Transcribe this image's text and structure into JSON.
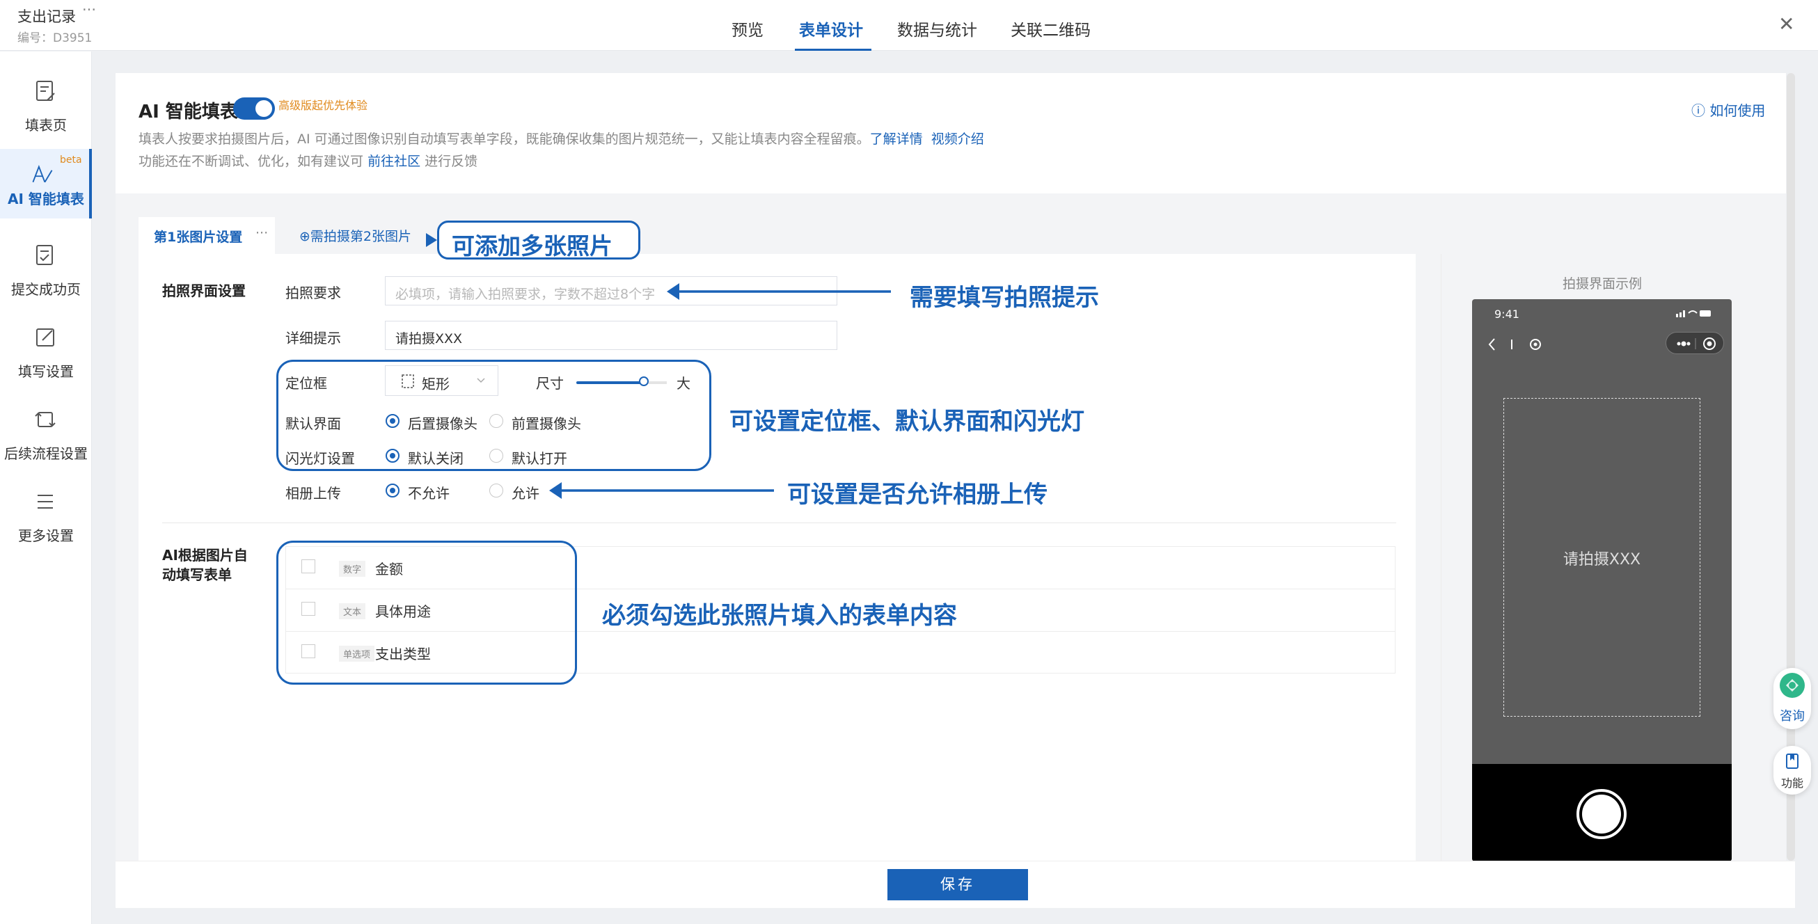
{
  "header": {
    "title": "支出记录",
    "more": "···",
    "subtitle": "编号：D3951",
    "tabs": [
      "预览",
      "表单设计",
      "数据与统计",
      "关联二维码"
    ],
    "active_tab": "表单设计",
    "close": "✕"
  },
  "sidebar": {
    "items": [
      {
        "label": "填表页",
        "icon": "form-page-icon"
      },
      {
        "label": "AI 智能填表",
        "icon": "ai-fill-icon",
        "badge": "beta",
        "active": true
      },
      {
        "label": "提交成功页",
        "icon": "submit-success-icon"
      },
      {
        "label": "填写设置",
        "icon": "fill-settings-icon"
      },
      {
        "label": "后续流程设置",
        "icon": "workflow-icon"
      },
      {
        "label": "更多设置",
        "icon": "more-settings-icon"
      }
    ]
  },
  "ai_panel": {
    "title": "AI 智能填表",
    "toggle_on": true,
    "trial": "高级版起优先体验",
    "help": "如何使用",
    "desc_line1": "填表人按要求拍摄图片后，AI 可通过图像识别自动填写表单字段，既能确保收集的图片规范统一，又能让填表内容全程留痕。",
    "desc_link1": "了解详情",
    "desc_link2": "视频介绍",
    "desc_line2_a": "功能还在不断调试、优化，如有建议可",
    "desc_link3": "前往社区",
    "desc_line2_b": "进行反馈"
  },
  "photo_tabs": {
    "tab1": "第1张图片设置",
    "tab1_more": "···",
    "add": "⊕需拍摄第2张图片"
  },
  "capture_settings": {
    "section": "拍照界面设置",
    "requirement_label": "拍照要求",
    "requirement_placeholder": "必填项，请输入拍照要求，字数不超过8个字",
    "detail_label": "详细提示",
    "detail_value": "请拍摄XXX",
    "frame_label": "定位框",
    "frame_value": "矩形",
    "size_label": "尺寸",
    "size_value": "大",
    "size_level": 0.75,
    "default_view_label": "默认界面",
    "default_view_options": [
      "后置摄像头",
      "前置摄像头"
    ],
    "default_view_selected": "后置摄像头",
    "flash_label": "闪光灯设置",
    "flash_options": [
      "默认关闭",
      "默认打开"
    ],
    "flash_selected": "默认关闭",
    "album_label": "相册上传",
    "album_options": [
      "不允许",
      "允许"
    ],
    "album_selected": "不允许"
  },
  "auto_fill": {
    "section": "AI根据图片自动填写表单",
    "fields": [
      {
        "type": "数字",
        "name": "金额",
        "checked": false
      },
      {
        "type": "文本",
        "name": "具体用途",
        "checked": false
      },
      {
        "type": "单选项",
        "name": "支出类型",
        "checked": false
      }
    ]
  },
  "preview": {
    "label": "拍摄界面示例",
    "time": "9:41",
    "hint": "请拍摄XXX"
  },
  "footer": {
    "save": "保存"
  },
  "floating": {
    "consult": "咨询",
    "features": "功能"
  },
  "annotations": {
    "a1": "可添加多张照片",
    "a2": "需要填写拍照提示",
    "a3": "可设置定位框、默认界面和闪光灯",
    "a4": "可设置是否允许相册上传",
    "a5": "必须勾选此张照片填入的表单内容"
  },
  "colors": {
    "accent": "#1a62b7",
    "orange": "#e08a1d"
  }
}
